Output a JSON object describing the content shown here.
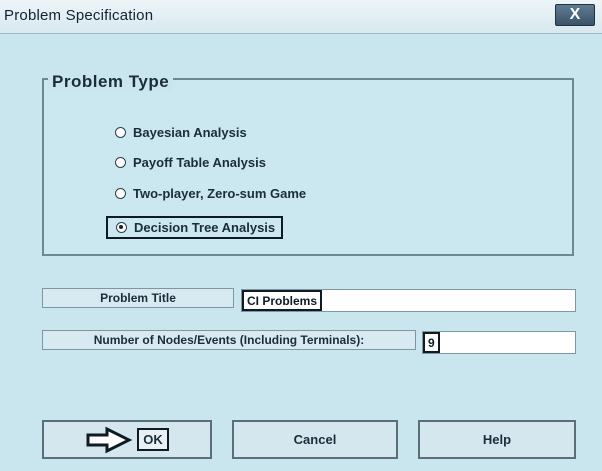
{
  "window": {
    "title": "Problem Specification",
    "close_label": "X"
  },
  "problem_type": {
    "legend": "Problem Type",
    "options": [
      {
        "label": "Bayesian Analysis",
        "selected": false
      },
      {
        "label": "Payoff Table Analysis",
        "selected": false
      },
      {
        "label": "Two-player, Zero-sum Game",
        "selected": false
      },
      {
        "label": "Decision Tree Analysis",
        "selected": true
      }
    ]
  },
  "fields": {
    "problem_title_label": "Problem Title",
    "problem_title_value": "CI Problems",
    "nodes_label": "Number of Nodes/Events (Including Terminals):",
    "nodes_value": "9"
  },
  "buttons": {
    "ok": "OK",
    "cancel": "Cancel",
    "help": "Help"
  },
  "icons": {
    "ok_indicator": "right-arrow-icon"
  }
}
